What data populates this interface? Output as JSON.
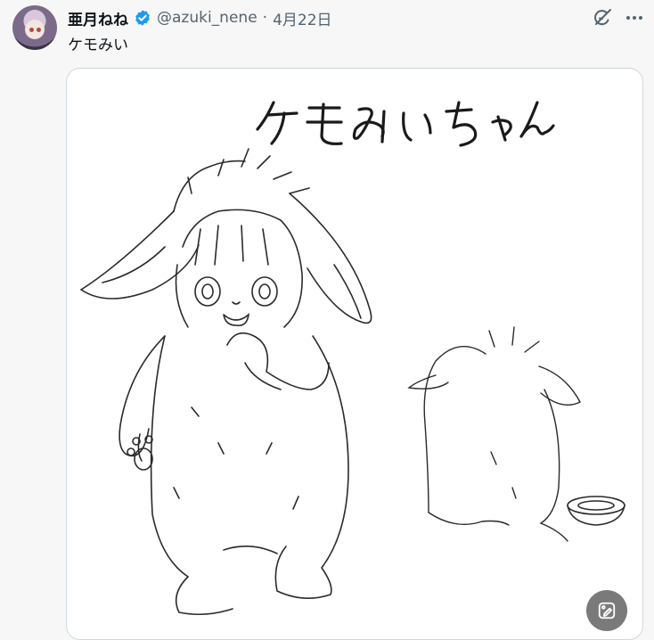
{
  "tweet": {
    "author_name": "亜月ねね",
    "handle": "@azuki_nene",
    "separator": "·",
    "date": "4月22日",
    "text": "ケモみい"
  },
  "media": {
    "artwork_caption": "ケモみいちゃん"
  },
  "icons": {
    "verified": "verified-badge-icon",
    "grok": "grok-icon",
    "more": "more-icon",
    "media_edit": "image-edit-icon"
  },
  "colors": {
    "verified": "#1d9bf0",
    "handle": "#536471",
    "border": "#cfd9de"
  }
}
